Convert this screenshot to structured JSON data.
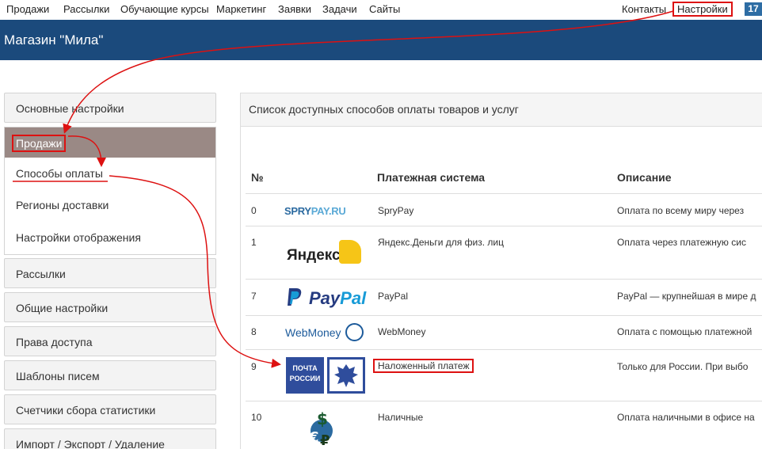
{
  "topnav": {
    "items": [
      "Продажи",
      "Рассылки",
      "Обучающие курсы",
      "Маркетинг",
      "Заявки",
      "Задачи",
      "Сайты",
      "Контакты",
      "Настройки"
    ],
    "badge": "17"
  },
  "header": {
    "title": "Магазин \"Мила\""
  },
  "sidebar": {
    "main_settings": "Основные настройки",
    "sales": "Продажи",
    "sub_items": [
      "Способы оплаты",
      "Регионы доставки",
      "Настройки отображения"
    ],
    "items": [
      "Рассылки",
      "Общие настройки",
      "Права доступа",
      "Шаблоны писем",
      "Счетчики сбора статистики",
      "Импорт / Экспорт / Удаление"
    ]
  },
  "panel": {
    "title": "Список доступных способов оплаты товаров и услуг",
    "columns": [
      "№",
      "Платежная система",
      "Описание"
    ],
    "rows": [
      {
        "num": "0",
        "name": "SpryPay",
        "desc": "Оплата по всему миру через",
        "logo": "sprypay-logo"
      },
      {
        "num": "1",
        "name": "Яндекс.Деньги для физ. лиц",
        "desc": "Оплата через платежную сис",
        "logo": "yandex-logo"
      },
      {
        "num": "7",
        "name": "PayPal",
        "desc": "PayPal — крупнейшая в мире д",
        "logo": "paypal-logo"
      },
      {
        "num": "8",
        "name": "WebMoney",
        "desc": "Оплата с помощью платежной",
        "logo": "webmoney-logo"
      },
      {
        "num": "9",
        "name": "Наложенный платеж",
        "desc": "Только для России. При выбо",
        "logo": "pochta-rossii-logo"
      },
      {
        "num": "10",
        "name": "Наличные",
        "desc": "Оплата наличными в офисе на",
        "logo": "cash-logo"
      }
    ]
  },
  "logos": {
    "spry_a": "SPRY",
    "spry_b": "PAY.RU",
    "yandex": "Яндекс",
    "paypal_a": "Pay",
    "paypal_b": "Pal",
    "webmoney": "WebMoney",
    "pochta_line1": "ПОЧТА",
    "pochta_line2": "РОССИИ"
  },
  "colors": {
    "header": "#1b4a7c",
    "active_sidebar": "#9a8985",
    "annotation": "#d11111"
  }
}
